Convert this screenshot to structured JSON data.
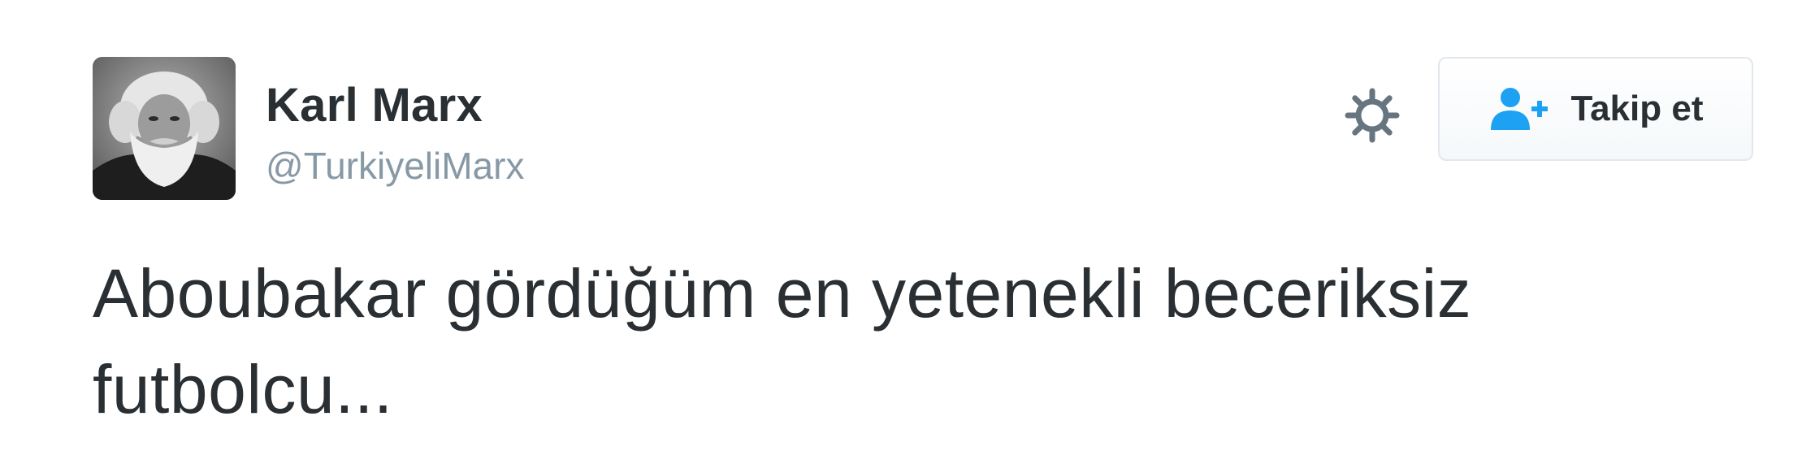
{
  "user": {
    "fullname": "Karl Marx",
    "screen_name": "@TurkiyeliMarx",
    "avatar_icon": "karl-marx-portrait"
  },
  "actions": {
    "settings_icon": "gear-icon",
    "follow_label": "Takip et",
    "follow_icon": "add-user-icon"
  },
  "tweet": {
    "text": "Aboubakar gördüğüm en yetenekli beceriksiz futbolcu..."
  },
  "colors": {
    "text": "#292f33",
    "muted": "#8899a6",
    "accent": "#1da1f2",
    "border": "#e1e8ed"
  }
}
